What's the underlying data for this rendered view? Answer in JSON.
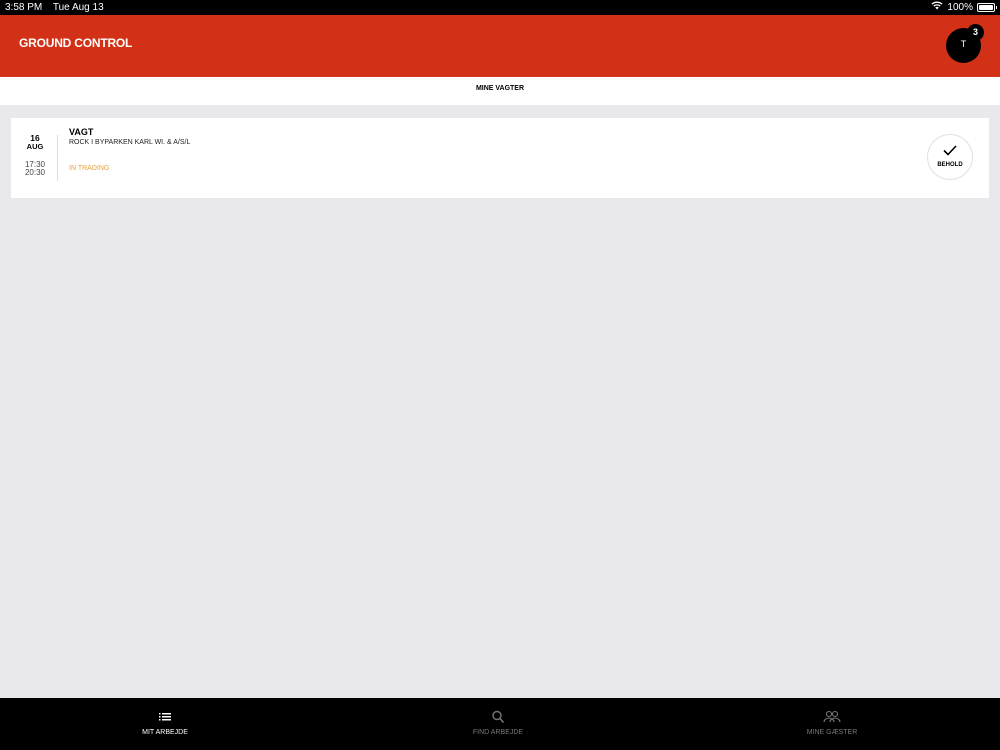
{
  "status_bar": {
    "time": "3:58 PM",
    "date": "Tue Aug 13",
    "battery": "100%",
    "battery_level": 1.0
  },
  "header": {
    "title": "GROUND CONTROL",
    "avatar_initial": "T",
    "notification_count": "3"
  },
  "top_tabs": [
    {
      "label": "MINE VAGTER"
    }
  ],
  "shift": {
    "day": "16",
    "month": "AUG",
    "start_time": "17:30",
    "end_time": "20:30",
    "title": "VAGT",
    "subtitle": "ROCK I BYPARKEN KARL WI. & A/S/L",
    "status": "IN TRADING",
    "action_label": "BEHOLD"
  },
  "bottom_nav": {
    "items": [
      {
        "label": "MIT ARBEJDE",
        "icon": "list-icon"
      },
      {
        "label": "FIND ARBEJDE",
        "icon": "search-icon"
      },
      {
        "label": "MINE GÆSTER",
        "icon": "guests-icon"
      }
    ]
  },
  "colors": {
    "header": "#d33117",
    "status_trading": "#e7a13a",
    "background": "#e9e9ed"
  }
}
